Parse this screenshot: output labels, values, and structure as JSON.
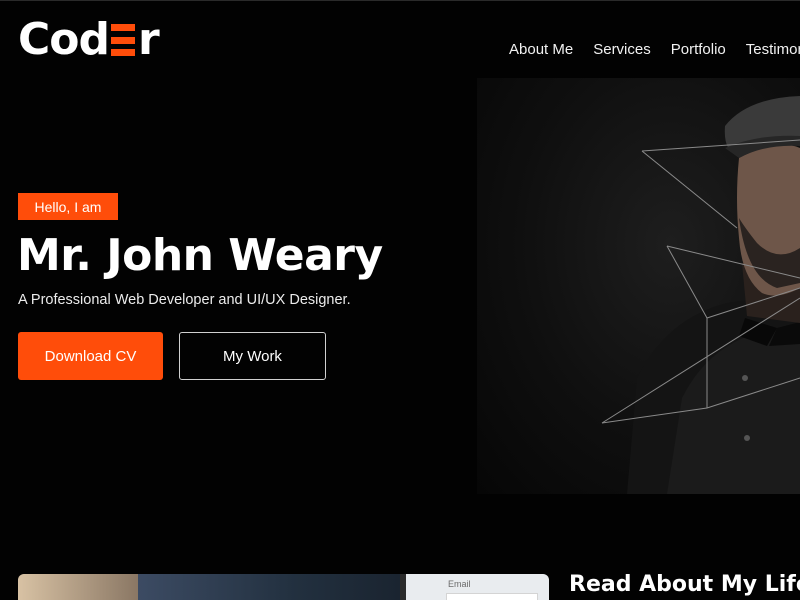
{
  "brand": {
    "logo_text_start": "Cod",
    "logo_text_end": "r",
    "accent_color": "#ff4d0a"
  },
  "nav": {
    "items": [
      {
        "label": "About Me"
      },
      {
        "label": "Services"
      },
      {
        "label": "Portfolio"
      },
      {
        "label": "Testimon"
      }
    ]
  },
  "hero": {
    "badge": "Hello, I am",
    "name": "Mr. John Weary",
    "subtitle": "A Professional Web Developer and UI/UX Designer.",
    "primary_button": "Download CV",
    "secondary_button": "My Work",
    "photo_icon": "portrait-photo"
  },
  "about": {
    "title": "Read About My Life",
    "thumb_email_label": "Email"
  }
}
